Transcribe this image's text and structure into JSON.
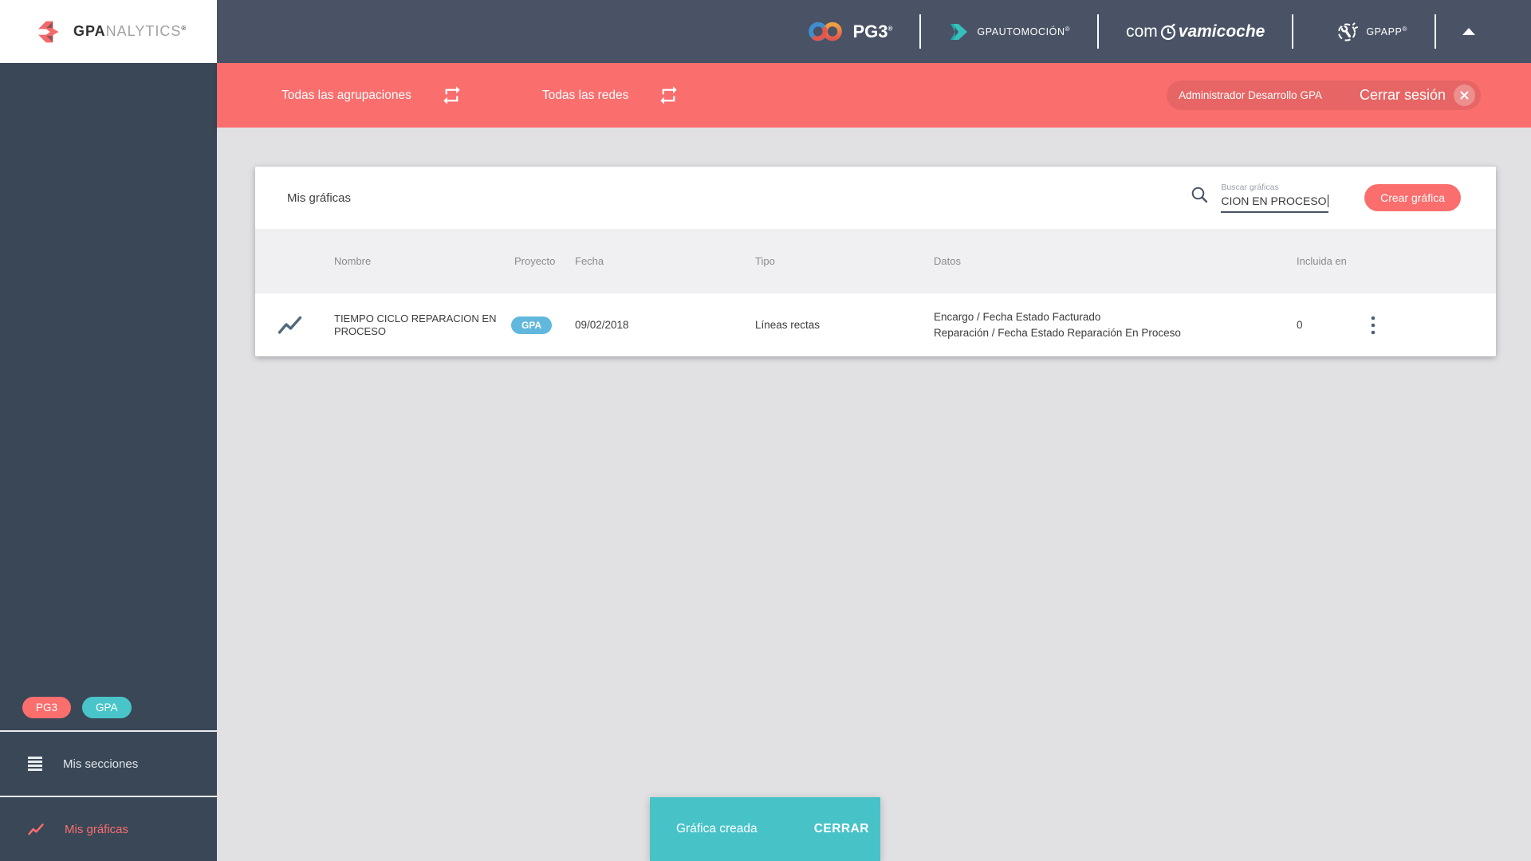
{
  "brand": {
    "analytics": {
      "bold": "GPA",
      "light": "NALYTICS",
      "reg": "®"
    }
  },
  "topbar": {
    "pg3": {
      "text": "PG3",
      "reg": "®"
    },
    "automocion": {
      "text": "GPAUTOMOCIÓN",
      "reg": "®"
    },
    "comprobamicoche": {
      "prefix": "com",
      "suffix": "vamicoche"
    },
    "gpapp": {
      "text": "GPAPP",
      "reg": "®"
    }
  },
  "filterbar": {
    "groupings_label": "Todas las agrupaciones",
    "networks_label": "Todas las redes",
    "user_name": "Administrador Desarrollo GPA",
    "logout_label": "Cerrar sesión"
  },
  "sidebar": {
    "badges": [
      {
        "label": "PG3",
        "color": "#fa6e6e"
      },
      {
        "label": "GPA",
        "color": "#49c5c9"
      }
    ],
    "items": [
      {
        "label": "Mis secciones",
        "active": false
      },
      {
        "label": "Mis gráficas",
        "active": true
      }
    ]
  },
  "page": {
    "title": "Mis gráficas",
    "search": {
      "label": "Buscar gráficas",
      "value": "CION EN PROCESO"
    },
    "create_button": "Crear gráfica"
  },
  "table": {
    "headers": [
      "Nombre",
      "Proyecto",
      "Fecha",
      "Tipo",
      "Datos",
      "Incluida en"
    ],
    "rows": [
      {
        "name": "TIEMPO CICLO REPARACION EN PROCESO",
        "project_badge": "GPA",
        "date": "09/02/2018",
        "type": "Líneas rectas",
        "data_lines": [
          "Encargo / Fecha Estado Facturado",
          "Reparación / Fecha Estado Reparación En Proceso"
        ],
        "included_in": "0"
      }
    ]
  },
  "snackbar": {
    "message": "Gráfica creada",
    "action": "CERRAR"
  },
  "icons": {
    "sidebar_menu": "hamburger-icon",
    "charts": "line-chart-icon",
    "filters": "repeat-icon",
    "search": "search-icon",
    "row_menu": "kebab-icon",
    "logout": "x-circle-icon",
    "header_collapse": "up-triangle-icon",
    "gpapp": "wrench-icon",
    "comprobamicoche": "stopwatch-icon"
  },
  "colors": {
    "accent_red": "#fa6e6e",
    "teal": "#47c3c8",
    "badge_blue": "#61b7dc",
    "topbar": "#4a5365",
    "sidebar": "#3a4757",
    "content_bg": "#e1e1e4"
  }
}
